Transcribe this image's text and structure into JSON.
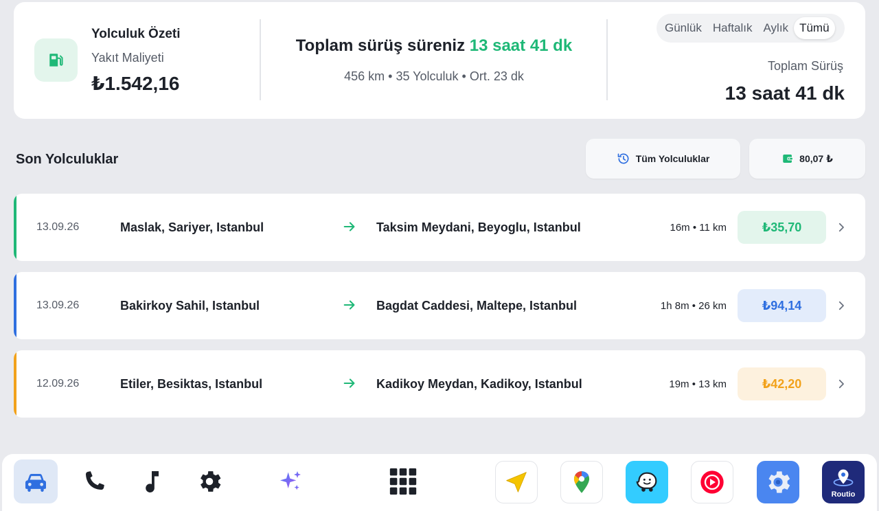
{
  "summary": {
    "title": "Yolculuk Özeti",
    "subtitle": "Yakıt Maliyeti",
    "fuel_cost": "₺1.542,16",
    "headline_prefix": "Toplam sürüş süreniz",
    "headline_value": "13 saat 41 dk",
    "stats": "456 km • 35 Yolculuk • Ort. 23 dk",
    "period_tabs": [
      "Günlük",
      "Haftalık",
      "Aylık",
      "Tümü"
    ],
    "active_tab": "Tümü",
    "total_label": "Toplam Sürüş",
    "total_value": "13 saat 41 dk"
  },
  "recent": {
    "title": "Son Yolculuklar",
    "all_trips_label": "Tüm Yolculuklar",
    "wallet_label": "80,07 ₺"
  },
  "trips": [
    {
      "date": "13.09.26",
      "from": "Maslak, Sariyer, Istanbul",
      "to": "Taksim Meydani, Beyoglu, Istanbul",
      "meta": "16m • 11 km",
      "price": "₺35,70",
      "accent": "#1fb877",
      "price_bg": "#e3f5ec"
    },
    {
      "date": "13.09.26",
      "from": "Bakirkoy Sahil, Istanbul",
      "to": "Bagdat Caddesi, Maltepe, Istanbul",
      "meta": "1h 8m • 26 km",
      "price": "₺94,14",
      "accent": "#2f6fe0",
      "price_bg": "#e3ecfb"
    },
    {
      "date": "12.09.26",
      "from": "Etiler, Besiktas, Istanbul",
      "to": "Kadikoy Meydan, Kadikoy, Istanbul",
      "meta": "19m • 13 km",
      "price": "₺42,20",
      "accent": "#f2a21b",
      "price_bg": "#fdf1de"
    }
  ],
  "dock": {
    "left_icons": [
      "car-icon",
      "phone-icon",
      "music-icon",
      "settings-icon",
      "sparkle-icon",
      "apps-grid-icon"
    ],
    "apps": [
      "navigation-app",
      "maps-app",
      "waze-app",
      "music-player-app",
      "settings-app",
      "routio-app"
    ],
    "routio_label": "Routio"
  },
  "colors": {
    "green": "#1fb877",
    "blue": "#2f6fe0",
    "orange": "#f2a21b",
    "dark": "#1d2129"
  }
}
